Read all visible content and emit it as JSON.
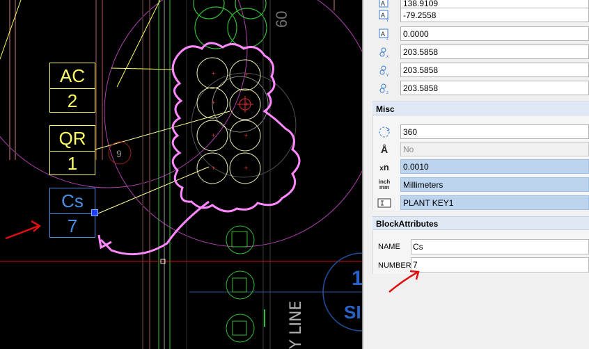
{
  "drawing": {
    "tags": [
      {
        "code": "AC",
        "number": "2"
      },
      {
        "code": "QR",
        "number": "1"
      },
      {
        "code": "Cs",
        "number": "7"
      }
    ],
    "small_label": "9",
    "top_right_label": "60",
    "bottom_text": "Y LINE",
    "circle_fragment_number": "1",
    "circle_fragment_text": "SI"
  },
  "properties": {
    "rows_top": [
      {
        "icon": "position-x-icon",
        "value": "138.9109"
      },
      {
        "icon": "position-y-icon",
        "value": "-79.2558"
      },
      {
        "icon": "position-z-icon",
        "value": "0.0000"
      },
      {
        "icon": "scale-x-icon",
        "value": "203.5858"
      },
      {
        "icon": "scale-y-icon",
        "value": "203.5858"
      },
      {
        "icon": "scale-z-icon",
        "value": "203.5858"
      }
    ],
    "misc_title": "Misc",
    "misc_rows": [
      {
        "icon": "rotation-icon",
        "value": "360"
      },
      {
        "icon": "annotative-icon",
        "value": "No"
      },
      {
        "icon": "unit-factor-icon",
        "value": "0.0010"
      },
      {
        "icon": "units-icon",
        "value": "Millimeters"
      },
      {
        "icon": "block-name-icon",
        "value": "PLANT KEY1"
      }
    ],
    "block_attributes": {
      "title": "BlockAttributes",
      "name_label": "NAME",
      "name_value": "Cs",
      "number_label": "NUMBER",
      "number_value": "7"
    }
  },
  "colors": {
    "tag_yellow": "#ffff66",
    "tag_selected": "#4a90e2",
    "pink": "#ff88ff",
    "magenta": "#c040c0",
    "green": "#33cc33",
    "red": "#e01010"
  }
}
